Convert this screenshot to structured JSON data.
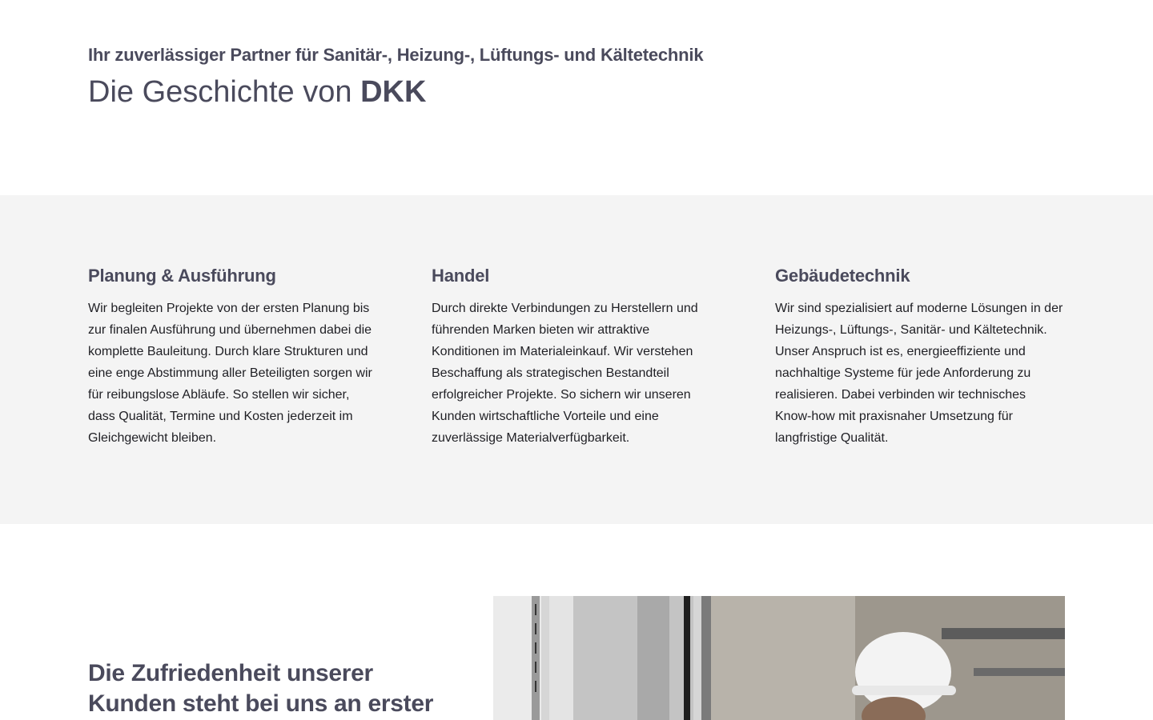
{
  "hero": {
    "kicker": "Ihr zuverlässiger Partner für Sanitär-, Heizung-, Lüftungs- und Kältetechnik",
    "title_prefix": "Die Geschichte von",
    "title_brand": "DKK"
  },
  "services": [
    {
      "title": "Planung & Ausführung",
      "text": "Wir begleiten Projekte von der ersten Planung bis zur finalen Ausführung und übernehmen dabei die komplette Bauleitung. Durch klare Strukturen und eine enge Abstimmung aller Beteiligten sorgen wir für reibungslose Abläufe. So stellen wir sicher, dass Qualität, Termine und Kosten jederzeit im Gleichgewicht bleiben."
    },
    {
      "title": "Handel",
      "text": "Durch direkte Verbindungen zu Herstellern und führenden Marken bieten wir attraktive Konditionen im Materialeinkauf. Wir verstehen Beschaffung als strategischen Bestandteil erfolgreicher Projekte. So sichern wir unseren Kunden wirtschaftliche Vorteile und eine zuverlässige Materialverfügbarkeit."
    },
    {
      "title": "Gebäudetechnik",
      "text": "Wir sind spezialisiert auf moderne Lösungen in der Heizungs-, Lüftungs-, Sanitär- und Kältetechnik. Unser Anspruch ist es, energieeffiziente und nachhaltige Systeme für jede Anforderung zu realisieren. Dabei verbinden wir technisches Know-how mit praxisnaher Umsetzung für langfristige Qualität."
    }
  ],
  "satisfaction": {
    "title": "Die Zufriedenheit unserer Kunden steht bei uns an erster"
  },
  "colors": {
    "heading": "#4a4a5c",
    "section_bg": "#f4f4f4",
    "body_text": "#1f1f24"
  }
}
